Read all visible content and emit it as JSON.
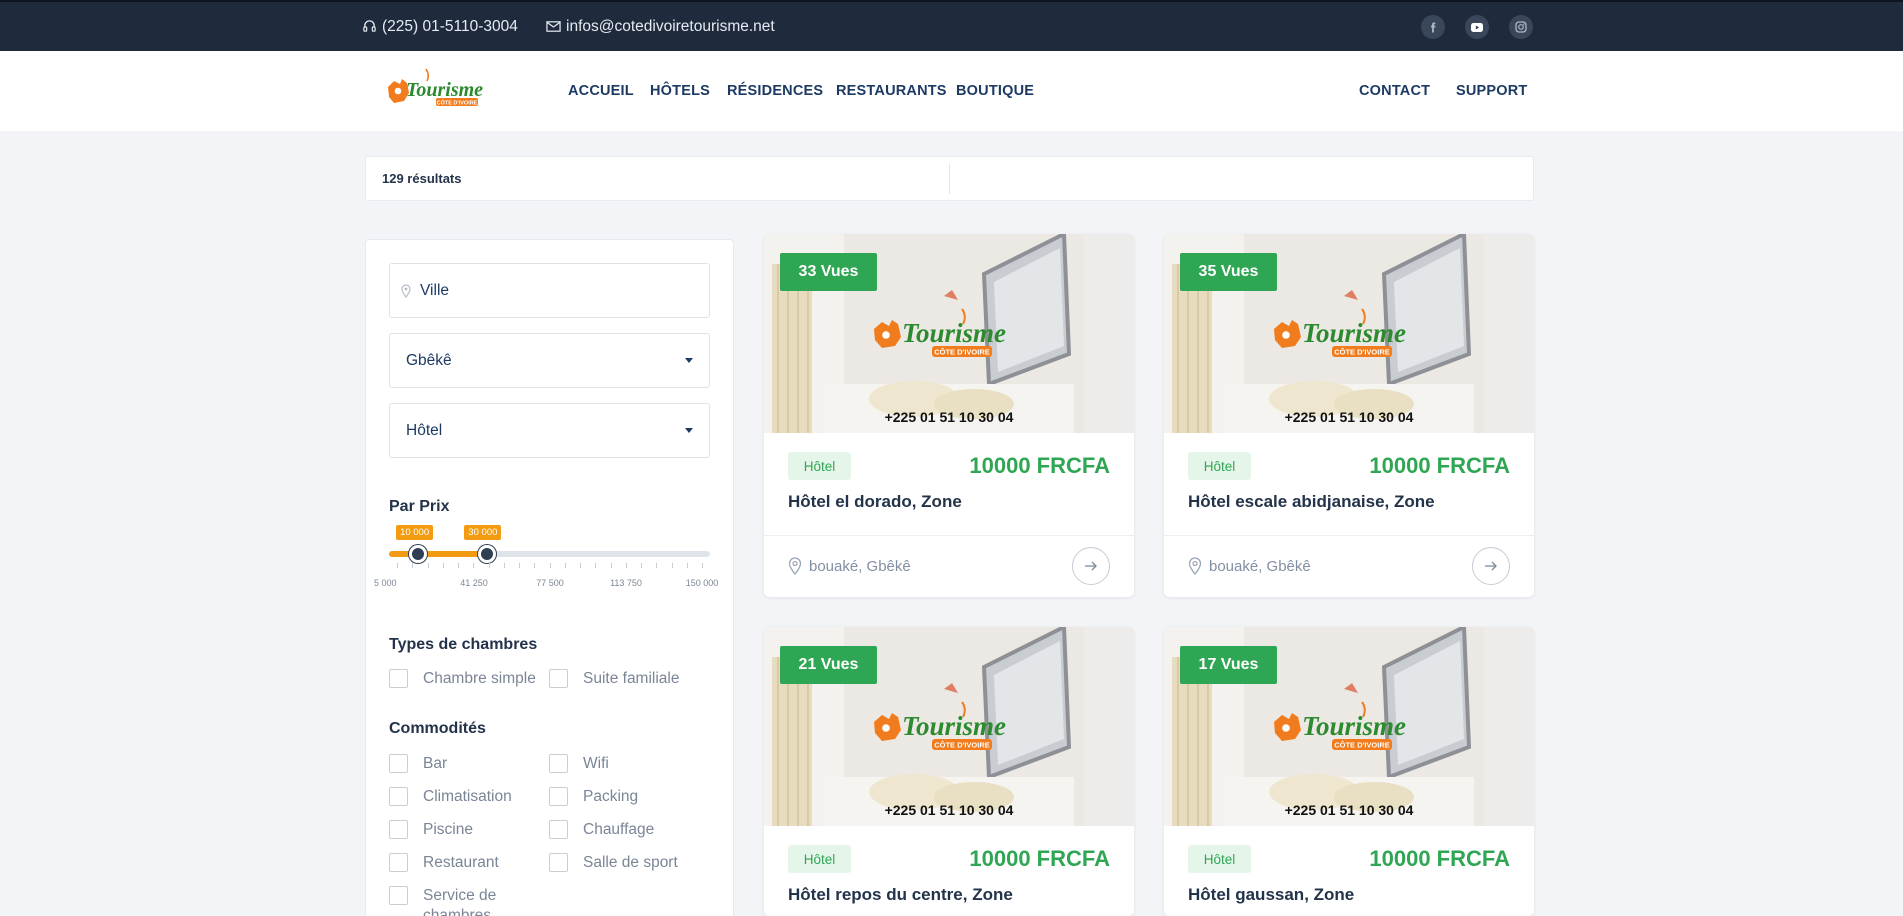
{
  "topbar": {
    "phone": "(225) 01-5110-3004",
    "email": "infos@cotedivoiretourisme.net",
    "social": [
      "facebook-icon",
      "youtube-icon",
      "instagram-icon"
    ]
  },
  "header": {
    "logo_text": "Tourisme",
    "logo_sub": "CÔTE D'IVOIRE",
    "nav": [
      "ACCUEIL",
      "HÔTELS",
      "RÉSIDENCES",
      "RESTAURANTS",
      "BOUTIQUE"
    ],
    "nav_right": [
      "CONTACT",
      "SUPPORT"
    ]
  },
  "results": {
    "count": "129 résultats"
  },
  "filters": {
    "city_placeholder": "Ville",
    "region": "Gbêkê",
    "category": "Hôtel",
    "price_title": "Par Prix",
    "price_min": "10 000",
    "price_max": "30 000",
    "price_ticks": [
      "5 000",
      "41 250",
      "77 500",
      "113 750",
      "150 000"
    ],
    "range_bounds": [
      5000,
      150000
    ],
    "range_values": [
      10000,
      30000
    ],
    "room_types_title": "Types de chambres",
    "room_types": [
      "Chambre simple",
      "Suite familiale"
    ],
    "amenities_title": "Commodités",
    "amenities": [
      "Bar",
      "Wifi",
      "Climatisation",
      "Packing",
      "Piscine",
      "Chauffage",
      "Restaurant",
      "Salle de sport",
      "Service de chambres"
    ]
  },
  "cards": [
    {
      "views": "33 Vues",
      "phone": "+225 01 51 10 30 04",
      "type": "Hôtel",
      "price": "10000 FRCFA",
      "title": "Hôtel el dorado, Zone",
      "location": "bouaké, Gbêkê"
    },
    {
      "views": "35 Vues",
      "phone": "+225 01 51 10 30 04",
      "type": "Hôtel",
      "price": "10000 FRCFA",
      "title": "Hôtel escale abidjanaise, Zone",
      "location": "bouaké, Gbêkê"
    },
    {
      "views": "21 Vues",
      "phone": "+225 01 51 10 30 04",
      "type": "Hôtel",
      "price": "10000 FRCFA",
      "title": "Hôtel repos du centre, Zone",
      "location": ""
    },
    {
      "views": "17 Vues",
      "phone": "+225 01 51 10 30 04",
      "type": "Hôtel",
      "price": "10000 FRCFA",
      "title": "Hôtel gaussan, Zone",
      "location": ""
    }
  ],
  "colors": {
    "accent_green": "#2fa654",
    "accent_orange": "#f39c12",
    "navy": "#1d3a63",
    "topbar": "#1f2b3d"
  }
}
